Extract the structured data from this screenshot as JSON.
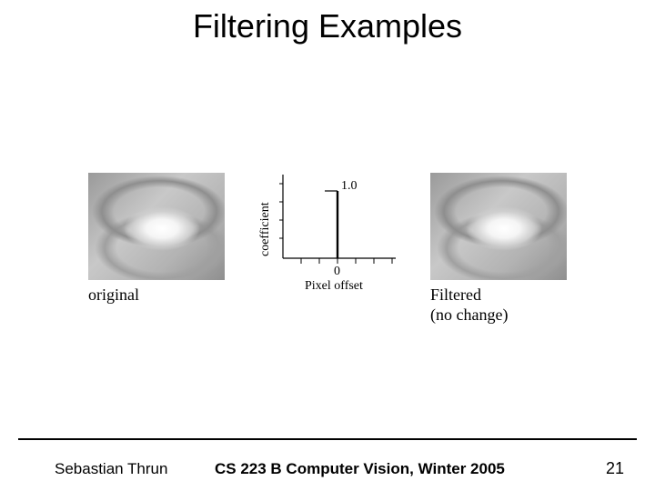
{
  "title": "Filtering Examples",
  "panels": {
    "original": {
      "caption": "original"
    },
    "filtered": {
      "caption_line1": "Filtered",
      "caption_line2": "(no change)"
    }
  },
  "filter_plot": {
    "y_axis_label": "coefficient",
    "x_axis_label": "Pixel offset",
    "value_label": "1.0",
    "zero_label": "0"
  },
  "footer": {
    "author": "Sebastian Thrun",
    "course": "CS 223 B Computer Vision, Winter 2005",
    "page": "21"
  }
}
